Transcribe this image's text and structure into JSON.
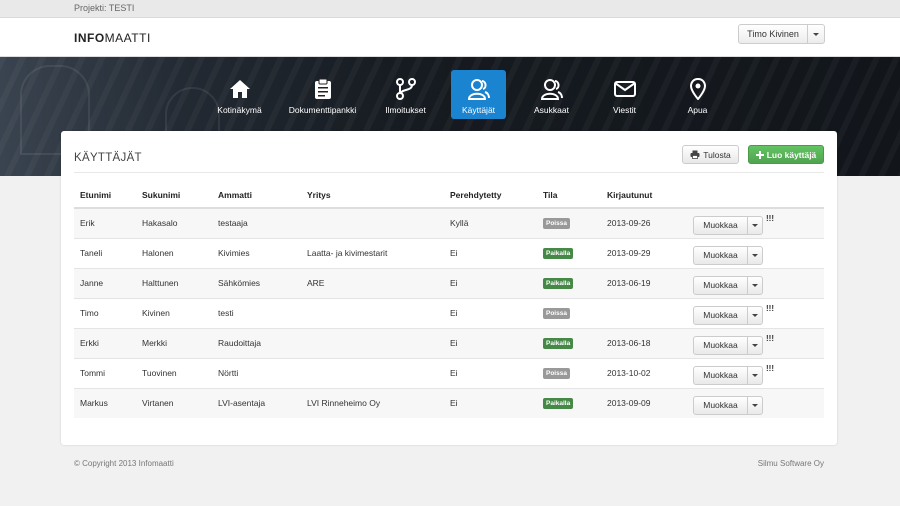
{
  "project_bar": {
    "label": "Projekti: TESTI"
  },
  "header": {
    "logo_bold": "INFO",
    "logo_light": "MAATTI",
    "user_name": "Timo Kivinen"
  },
  "nav": {
    "items": [
      {
        "label": "Kotinäkymä",
        "icon": "home-icon"
      },
      {
        "label": "Dokumenttipankki",
        "icon": "clipboard-icon"
      },
      {
        "label": "Ilmoitukset",
        "icon": "branch-icon"
      },
      {
        "label": "Käyttäjät",
        "icon": "users-icon",
        "active": true
      },
      {
        "label": "Asukkaat",
        "icon": "residents-icon"
      },
      {
        "label": "Viestit",
        "icon": "envelope-icon"
      },
      {
        "label": "Apua",
        "icon": "map-pin-icon"
      }
    ],
    "active_color": "#1a84d1"
  },
  "card": {
    "title": "KÄYTTÄJÄT",
    "print_label": "Tulosta",
    "create_label": "Luo käyttäjä"
  },
  "table": {
    "headers": [
      "Etunimi",
      "Sukunimi",
      "Ammatti",
      "Yritys",
      "Perehdytetty",
      "Tila",
      "Kirjautunut"
    ],
    "rows": [
      {
        "first": "Erik",
        "last": "Hakasalo",
        "job": "testaaja",
        "company": "",
        "trained": "Kyllä",
        "status": "Poissa",
        "status_type": "gray",
        "login": "2013-09-26",
        "action": "Muokkaa",
        "warn": "!!!"
      },
      {
        "first": "Taneli",
        "last": "Halonen",
        "job": "Kivimies",
        "company": "Laatta- ja kivimestarit",
        "trained": "Ei",
        "status": "Paikalla",
        "status_type": "green",
        "login": "2013-09-29",
        "action": "Muokkaa",
        "warn": ""
      },
      {
        "first": "Janne",
        "last": "Halttunen",
        "job": "Sähkömies",
        "company": "ARE",
        "trained": "Ei",
        "status": "Paikalla",
        "status_type": "green",
        "login": "2013-06-19",
        "action": "Muokkaa",
        "warn": ""
      },
      {
        "first": "Timo",
        "last": "Kivinen",
        "job": "testi",
        "company": "",
        "trained": "Ei",
        "status": "Poissa",
        "status_type": "gray",
        "login": "",
        "action": "Muokkaa",
        "warn": "!!!"
      },
      {
        "first": "Erkki",
        "last": "Merkki",
        "job": "Raudoittaja",
        "company": "",
        "trained": "Ei",
        "status": "Paikalla",
        "status_type": "green",
        "login": "2013-06-18",
        "action": "Muokkaa",
        "warn": "!!!"
      },
      {
        "first": "Tommi",
        "last": "Tuovinen",
        "job": "Nörtti",
        "company": "",
        "trained": "Ei",
        "status": "Poissa",
        "status_type": "gray",
        "login": "2013-10-02",
        "action": "Muokkaa",
        "warn": "!!!"
      },
      {
        "first": "Markus",
        "last": "Virtanen",
        "job": "LVI-asentaja",
        "company": "LVI Rinneheimo Oy",
        "trained": "Ei",
        "status": "Paikalla",
        "status_type": "green",
        "login": "2013-09-09",
        "action": "Muokkaa",
        "warn": ""
      }
    ]
  },
  "footer": {
    "copyright": "© Copyright 2013 Infomaatti",
    "company": "Silmu Software Oy"
  }
}
